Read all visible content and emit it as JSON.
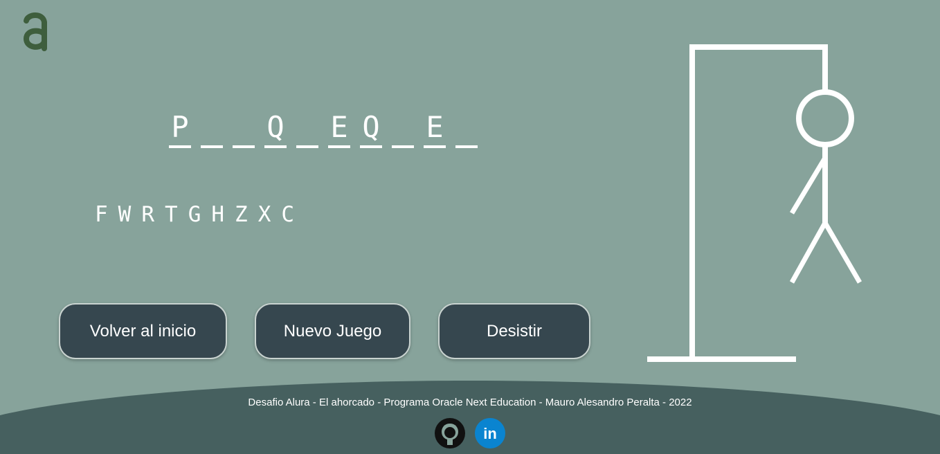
{
  "game": {
    "word_slots": [
      "P",
      "",
      "",
      "Q",
      "",
      "E",
      "Q",
      "",
      "E",
      ""
    ],
    "wrong_letters": [
      "F",
      "W",
      "R",
      "T",
      "G",
      "H",
      "Z",
      "X",
      "C"
    ],
    "hangman_parts_shown": [
      "head",
      "body",
      "left-arm",
      "left-leg",
      "right-leg"
    ]
  },
  "buttons": {
    "home_label": "Volver al inicio",
    "new_game_label": "Nuevo Juego",
    "give_up_label": "Desistir"
  },
  "footer": {
    "credits": "Desafio Alura - El ahorcado - Programa Oracle Next Education - Mauro Alesandro Peralta - 2022",
    "icons": [
      "github-icon",
      "linkedin-icon"
    ],
    "linkedin_text": "in"
  },
  "colors": {
    "background": "#87a39b",
    "button": "#36474f",
    "footer": "#46605f",
    "logo": "#3e5e3d",
    "linkedin": "#0a84d0"
  }
}
